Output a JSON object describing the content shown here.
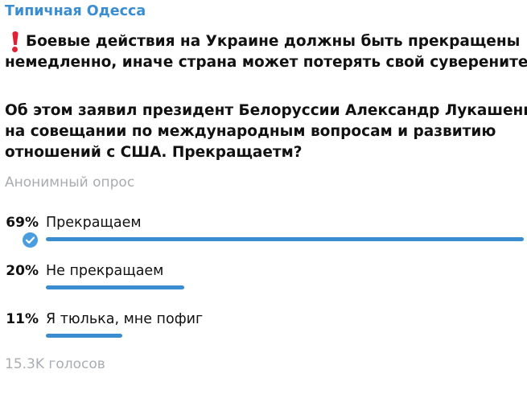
{
  "channel": {
    "name": "Типичная Одесса"
  },
  "message": {
    "alert_icon": "red-exclamation-icon",
    "headline_line1": "Боевые действия на Украине должны быть прекращены",
    "headline_line2": "немедленно, иначе страна может потерять свой суверенитет",
    "body_line1": "Об этом заявил президент Белоруссии Александр Лукашенко",
    "body_line2": "на совещании по международным вопросам и развитию",
    "body_line3": "отношений с США.  Прекращаетм?"
  },
  "poll": {
    "type_label": "Анонимный опрос",
    "accent_color": "#3a8dd0",
    "options": [
      {
        "percent_text": "69%",
        "percent": 69,
        "text": "Прекращаем",
        "chosen": true
      },
      {
        "percent_text": "20%",
        "percent": 20,
        "text": "Не прекращаем",
        "chosen": false
      },
      {
        "percent_text": "11%",
        "percent": 11,
        "text": "Я тюлька, мне пофиг",
        "chosen": false
      }
    ],
    "total_votes": "15.3K голосов"
  }
}
